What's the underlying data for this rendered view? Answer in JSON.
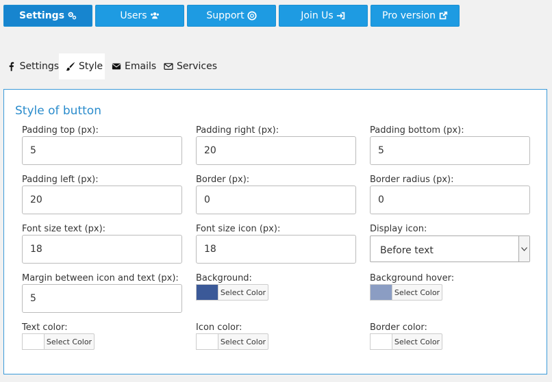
{
  "topbar": {
    "buttons": [
      {
        "label": "Settings",
        "icon": "gears-icon",
        "active": true
      },
      {
        "label": "Users",
        "icon": "users-icon",
        "active": false
      },
      {
        "label": "Support",
        "icon": "life-ring-icon",
        "active": false
      },
      {
        "label": "Join Us",
        "icon": "sign-in-icon",
        "active": false
      },
      {
        "label": "Pro version",
        "icon": "external-link-icon",
        "active": false
      }
    ],
    "accent": "#1e9be2"
  },
  "tabs": [
    {
      "label": "Settings",
      "icon": "facebook-icon",
      "active": false
    },
    {
      "label": "Style",
      "icon": "paint-brush-icon",
      "active": true
    },
    {
      "label": "Emails",
      "icon": "envelope-icon",
      "active": false
    },
    {
      "label": "Services",
      "icon": "envelope-outline-icon",
      "active": false
    }
  ],
  "panel": {
    "title": "Style of button",
    "fields": {
      "padding_top": {
        "label": "Padding top (px):",
        "value": "5"
      },
      "padding_right": {
        "label": "Padding right (px):",
        "value": "20"
      },
      "padding_bottom": {
        "label": "Padding bottom (px):",
        "value": "5"
      },
      "padding_left": {
        "label": "Padding left (px):",
        "value": "20"
      },
      "border": {
        "label": "Border (px):",
        "value": "0"
      },
      "border_radius": {
        "label": "Border radius (px):",
        "value": "0"
      },
      "font_size_text": {
        "label": "Font size text (px):",
        "value": "18"
      },
      "font_size_icon": {
        "label": "Font size icon (px):",
        "value": "18"
      },
      "display_icon": {
        "label": "Display icon:",
        "value": "Before text"
      },
      "margin_icon_text": {
        "label": "Margin between icon and text (px):",
        "value": "5"
      }
    },
    "colors": {
      "button_label": "Select Color",
      "background": {
        "label": "Background:",
        "color": "#3b5998"
      },
      "background_hover": {
        "label": "Background hover:",
        "color": "#8b9dc3"
      },
      "text_color": {
        "label": "Text color:",
        "color": "#ffffff"
      },
      "icon_color": {
        "label": "Icon color:",
        "color": "#ffffff"
      },
      "border_color": {
        "label": "Border color:",
        "color": "#ffffff"
      }
    }
  }
}
